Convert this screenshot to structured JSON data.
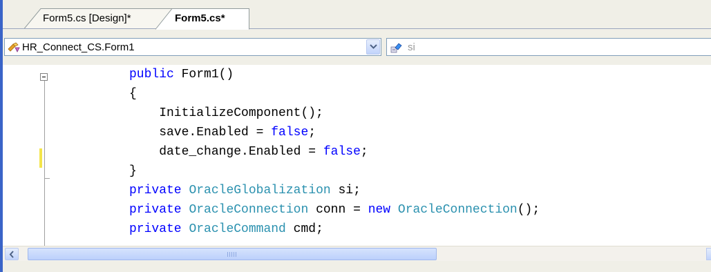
{
  "tabs": [
    {
      "label": "Form5.cs [Design]*",
      "active": false
    },
    {
      "label": "Form5.cs*",
      "active": true
    }
  ],
  "navbar": {
    "class_combo": {
      "value": "HR_Connect_CS.Form1",
      "icon": "class-icon"
    },
    "member_combo": {
      "value": "si",
      "icon": "field-icon"
    }
  },
  "code": {
    "lines": [
      [
        {
          "t": "public",
          "k": "kw"
        },
        {
          "t": " Form1()",
          "k": ""
        }
      ],
      [
        {
          "t": "{",
          "k": ""
        }
      ],
      [
        {
          "t": "    InitializeComponent();",
          "k": ""
        }
      ],
      [
        {
          "t": "    save.Enabled = ",
          "k": ""
        },
        {
          "t": "false",
          "k": "kw"
        },
        {
          "t": ";",
          "k": ""
        }
      ],
      [
        {
          "t": "    date_change.Enabled = ",
          "k": ""
        },
        {
          "t": "false",
          "k": "kw"
        },
        {
          "t": ";",
          "k": ""
        }
      ],
      [
        {
          "t": "}",
          "k": ""
        }
      ],
      [
        {
          "t": "private",
          "k": "kw"
        },
        {
          "t": " ",
          "k": ""
        },
        {
          "t": "OracleGlobalization",
          "k": "ty"
        },
        {
          "t": " si;",
          "k": ""
        }
      ],
      [
        {
          "t": "private",
          "k": "kw"
        },
        {
          "t": " ",
          "k": ""
        },
        {
          "t": "OracleConnection",
          "k": "ty"
        },
        {
          "t": " conn = ",
          "k": ""
        },
        {
          "t": "new",
          "k": "kw"
        },
        {
          "t": " ",
          "k": ""
        },
        {
          "t": "OracleConnection",
          "k": "ty"
        },
        {
          "t": "();",
          "k": ""
        }
      ],
      [
        {
          "t": "private",
          "k": "kw"
        },
        {
          "t": " ",
          "k": ""
        },
        {
          "t": "OracleCommand",
          "k": "ty"
        },
        {
          "t": " cmd;",
          "k": ""
        }
      ]
    ]
  },
  "colors": {
    "keyword": "#0000ff",
    "type": "#2b91af",
    "changed_line_marker": "#f4e54a"
  }
}
